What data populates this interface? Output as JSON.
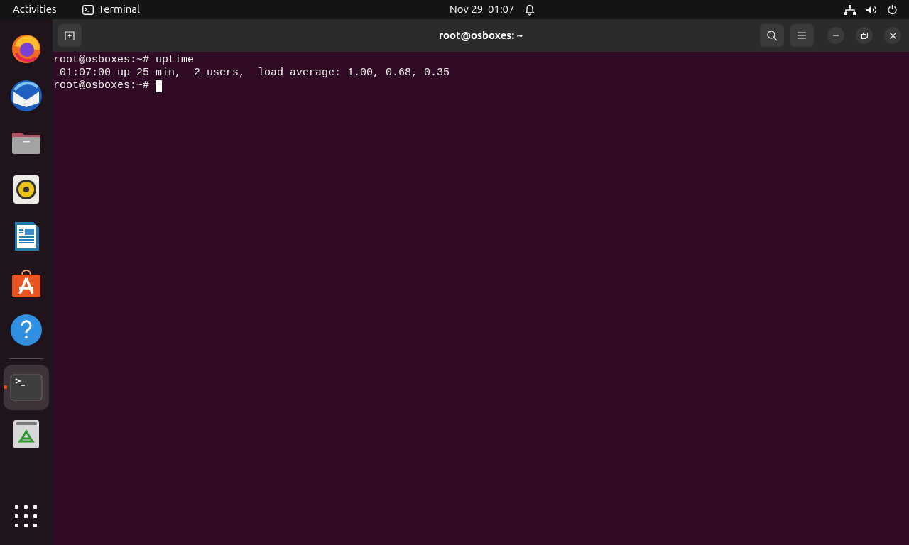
{
  "top_bar": {
    "activities": "Activities",
    "app_name": "Terminal",
    "clock": "Nov 29  01:07"
  },
  "dock": {
    "items": [
      {
        "kind": "firefox",
        "running": false,
        "selected": false
      },
      {
        "kind": "mail",
        "running": false,
        "selected": false
      },
      {
        "kind": "files",
        "running": false,
        "selected": false
      },
      {
        "kind": "speaker",
        "running": false,
        "selected": false
      },
      {
        "kind": "writer",
        "running": false,
        "selected": false
      },
      {
        "kind": "store",
        "running": false,
        "selected": false
      },
      {
        "kind": "help",
        "running": false,
        "selected": false
      },
      {
        "kind": "terminal",
        "running": true,
        "selected": true
      },
      {
        "kind": "trash",
        "running": false,
        "selected": false
      }
    ]
  },
  "window": {
    "title": "root@osboxes: ~"
  },
  "terminal": {
    "lines": [
      {
        "prompt": "root@osboxes:~#",
        "command": "uptime",
        "cursor": false
      },
      {
        "output": " 01:07:00 up 25 min,  2 users,  load average: 1.00, 0.68, 0.35",
        "cursor": false
      },
      {
        "prompt": "root@osboxes:~#",
        "cursor": true
      }
    ]
  }
}
